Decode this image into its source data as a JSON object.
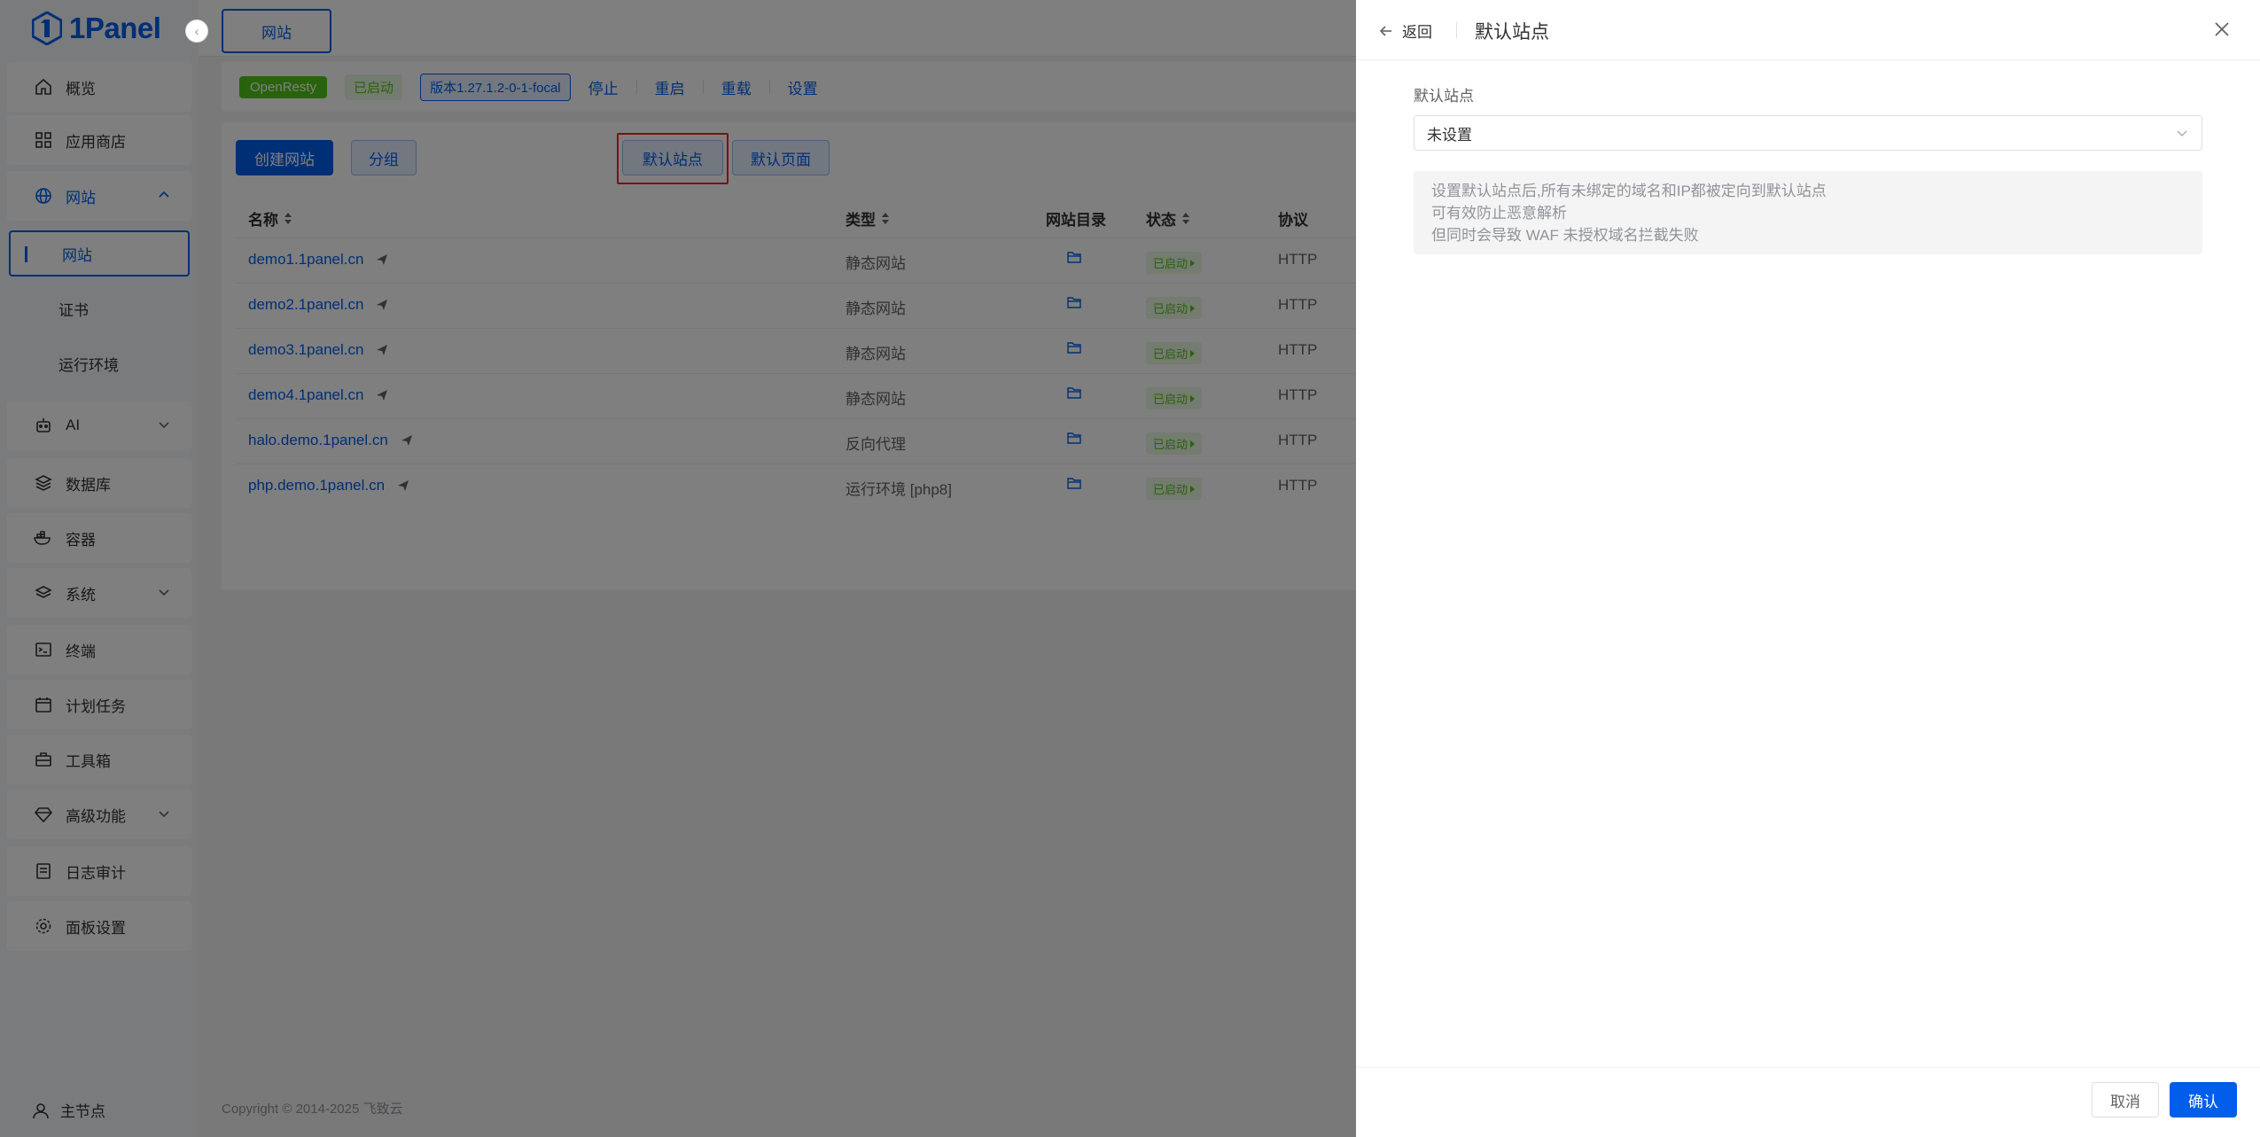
{
  "brand": {
    "name": "1Panel"
  },
  "sidebar": {
    "items": [
      {
        "label": "概览"
      },
      {
        "label": "应用商店"
      },
      {
        "label": "网站"
      },
      {
        "label": "AI"
      },
      {
        "label": "数据库"
      },
      {
        "label": "容器"
      },
      {
        "label": "系统"
      },
      {
        "label": "终端"
      },
      {
        "label": "计划任务"
      },
      {
        "label": "工具箱"
      },
      {
        "label": "高级功能"
      },
      {
        "label": "日志审计"
      },
      {
        "label": "面板设置"
      }
    ],
    "website_sub": [
      {
        "label": "网站"
      },
      {
        "label": "证书"
      },
      {
        "label": "运行环境"
      }
    ],
    "node": "主节点"
  },
  "topbar": {
    "tab": "网站"
  },
  "appbar": {
    "app_name": "OpenResty",
    "status": "已启动",
    "version": "版本1.27.1.2-0-1-focal",
    "actions": [
      "停止",
      "重启",
      "重载",
      "设置"
    ]
  },
  "toolbar": {
    "create": "创建网站",
    "group": "分组",
    "default_site": "默认站点",
    "default_page": "默认页面"
  },
  "table": {
    "headers": {
      "name": "名称",
      "type": "类型",
      "dir": "网站目录",
      "status": "状态",
      "protocol": "协议"
    },
    "rows": [
      {
        "name": "demo1.1panel.cn",
        "type": "静态网站",
        "status": "已启动",
        "protocol": "HTTP"
      },
      {
        "name": "demo2.1panel.cn",
        "type": "静态网站",
        "status": "已启动",
        "protocol": "HTTP"
      },
      {
        "name": "demo3.1panel.cn",
        "type": "静态网站",
        "status": "已启动",
        "protocol": "HTTP"
      },
      {
        "name": "demo4.1panel.cn",
        "type": "静态网站",
        "status": "已启动",
        "protocol": "HTTP"
      },
      {
        "name": "halo.demo.1panel.cn",
        "type": "反向代理",
        "status": "已启动",
        "protocol": "HTTP"
      },
      {
        "name": "php.demo.1panel.cn",
        "type": "运行环境 [php8]",
        "status": "已启动",
        "protocol": "HTTP"
      }
    ]
  },
  "footer": {
    "copyright": "Copyright © 2014-2025 飞致云"
  },
  "drawer": {
    "back": "返回",
    "title": "默认站点",
    "field_label": "默认站点",
    "select_value": "未设置",
    "notes": [
      "设置默认站点后,所有未绑定的域名和IP都被定向到默认站点",
      "可有效防止恶意解析",
      "但同时会导致 WAF 未授权域名拦截失败"
    ],
    "cancel": "取消",
    "confirm": "确认"
  },
  "colors": {
    "primary": "#005eeb",
    "success": "#52c41a",
    "highlight": "#f5222d"
  }
}
